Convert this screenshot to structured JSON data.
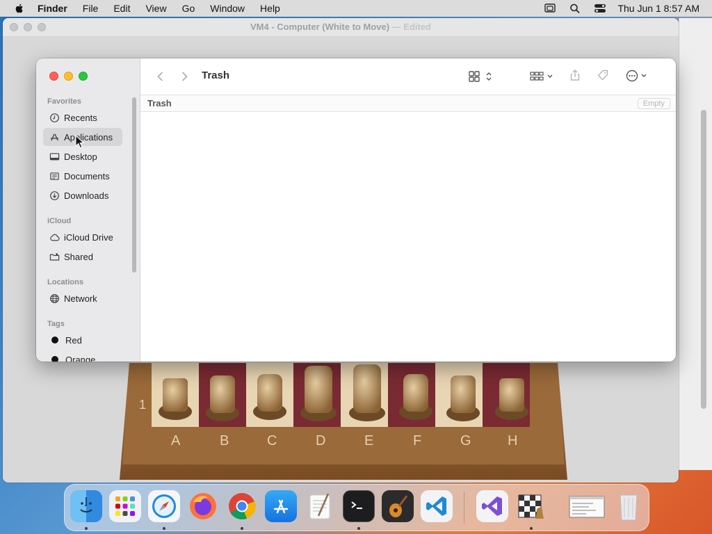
{
  "menubar": {
    "app_name": "Finder",
    "items": [
      "File",
      "Edit",
      "View",
      "Go",
      "Window",
      "Help"
    ],
    "clock": "Thu Jun 1  8:57 AM"
  },
  "vm_window": {
    "title": "VM4 - Computer   (White to Move)",
    "edited": "— Edited",
    "board_files": [
      "A",
      "B",
      "C",
      "D",
      "E",
      "F",
      "G",
      "H"
    ],
    "board_rank": "1"
  },
  "finder": {
    "title": "Trash",
    "path": "Trash",
    "empty_button": "Empty",
    "sidebar": {
      "favorites_label": "Favorites",
      "favorites": [
        {
          "label": "Recents",
          "icon": "clock-icon"
        },
        {
          "label": "Applications",
          "icon": "applications-icon",
          "selected": true
        },
        {
          "label": "Desktop",
          "icon": "desktop-icon"
        },
        {
          "label": "Documents",
          "icon": "document-icon"
        },
        {
          "label": "Downloads",
          "icon": "download-icon"
        }
      ],
      "icloud_label": "iCloud",
      "icloud": [
        {
          "label": "iCloud Drive",
          "icon": "cloud-icon"
        },
        {
          "label": "Shared",
          "icon": "shared-folder-icon"
        }
      ],
      "locations_label": "Locations",
      "locations": [
        {
          "label": "Network",
          "icon": "globe-icon"
        }
      ],
      "tags_label": "Tags",
      "tags": [
        {
          "label": "Red",
          "color": "#111111"
        },
        {
          "label": "Orange",
          "color": "#111111"
        }
      ]
    }
  },
  "dock": {
    "apps": [
      "Finder",
      "Launchpad",
      "Safari",
      "Firefox",
      "Chrome",
      "App Store",
      "TextEdit",
      "Terminal",
      "Instruments",
      "Visual Studio Code",
      "Visual Studio",
      "Chess",
      "Screen Preview",
      "Trash"
    ]
  }
}
